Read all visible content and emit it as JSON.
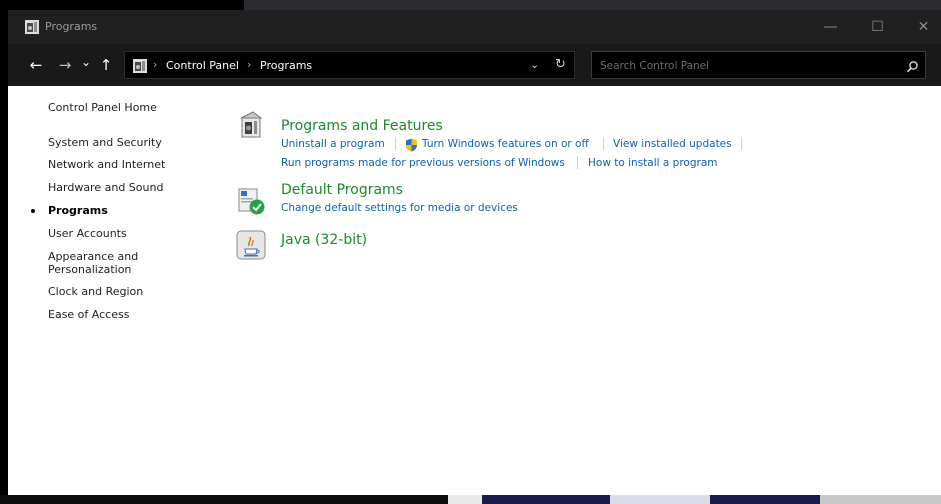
{
  "window": {
    "title": "Programs",
    "controls": {
      "minimize": "—",
      "maximize": "☐",
      "close": "✕"
    }
  },
  "navigation": {
    "back": "←",
    "forward": "→",
    "recent": "⌄",
    "up": "↑",
    "breadcrumbs": [
      "Control Panel",
      "Programs"
    ],
    "separator": "›",
    "dropdown": "⌄",
    "refresh": "↻"
  },
  "search": {
    "placeholder": "Search Control Panel",
    "value": ""
  },
  "sidebar": {
    "items": [
      {
        "label": "Control Panel Home",
        "current": false
      },
      {
        "label": "System and Security",
        "current": false
      },
      {
        "label": "Network and Internet",
        "current": false
      },
      {
        "label": "Hardware and Sound",
        "current": false
      },
      {
        "label": "Programs",
        "current": true
      },
      {
        "label": "User Accounts",
        "current": false
      },
      {
        "label": "Appearance and Personalization",
        "current": false
      },
      {
        "label": "Clock and Region",
        "current": false
      },
      {
        "label": "Ease of Access",
        "current": false
      }
    ]
  },
  "categories": [
    {
      "title": "Programs and Features",
      "icon": "programs-features-icon",
      "links": [
        "Uninstall a program",
        "Turn Windows features on or off",
        "View installed updates",
        "Run programs made for previous versions of Windows",
        "How to install a program"
      ]
    },
    {
      "title": "Default Programs",
      "icon": "default-programs-icon",
      "links": [
        "Change default settings for media or devices"
      ]
    },
    {
      "title": "Java (32-bit)",
      "icon": "java-icon",
      "links": []
    }
  ],
  "colors": {
    "titlebar": "#202020",
    "navbar": "#191919",
    "category_title": "#1b8a2a",
    "link": "#0f5fb4"
  }
}
